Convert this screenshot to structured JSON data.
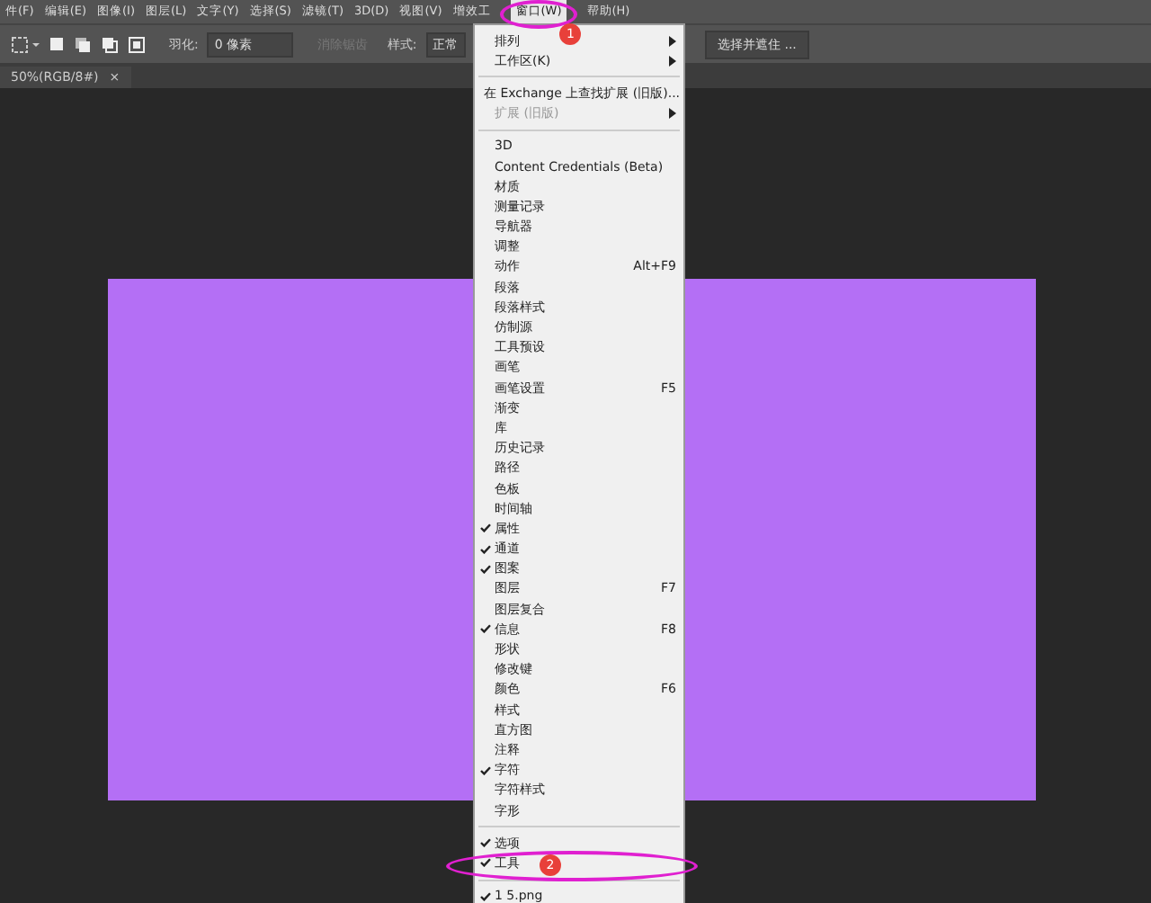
{
  "menubar": [
    {
      "label": "件(F)",
      "selected": false
    },
    {
      "label": "编辑(E)",
      "selected": false
    },
    {
      "label": "图像(I)",
      "selected": false
    },
    {
      "label": "图层(L)",
      "selected": false
    },
    {
      "label": "文字(Y)",
      "selected": false
    },
    {
      "label": "选择(S)",
      "selected": false
    },
    {
      "label": "滤镜(T)",
      "selected": false
    },
    {
      "label": "3D(D)",
      "selected": false
    },
    {
      "label": "视图(V)",
      "selected": false
    },
    {
      "label": "增效工",
      "selected": false
    },
    {
      "label": "窗口(W)",
      "selected": true
    },
    {
      "label": "帮助(H)",
      "selected": false
    }
  ],
  "options_bar": {
    "feather_label": "羽化:",
    "feather_value": "0 像素",
    "antialias": {
      "label": "消除锯齿",
      "disabled": true
    },
    "style_label": "样式:",
    "style_value": "正常",
    "select_mask_button": "选择并遮住 ..."
  },
  "document_tab": {
    "title": "50%(RGB/8#)",
    "close": "×"
  },
  "window_menu": [
    {
      "kind": "item",
      "label": "排列",
      "checked": false,
      "submenu": true,
      "disabled": false
    },
    {
      "kind": "item",
      "label": "工作区(K)",
      "checked": false,
      "submenu": true,
      "disabled": false
    },
    {
      "kind": "separator"
    },
    {
      "kind": "item",
      "label": "在 Exchange 上查找扩展 (旧版)...",
      "checked": false,
      "submenu": false,
      "disabled": false
    },
    {
      "kind": "item",
      "label": "扩展 (旧版)",
      "checked": false,
      "submenu": true,
      "disabled": true
    },
    {
      "kind": "separator"
    },
    {
      "kind": "item",
      "label": "3D",
      "checked": false,
      "submenu": false,
      "disabled": false
    },
    {
      "kind": "item",
      "label": "Content Credentials (Beta)",
      "checked": false,
      "submenu": false,
      "disabled": false
    },
    {
      "kind": "item",
      "label": "材质",
      "checked": false,
      "submenu": false,
      "disabled": false
    },
    {
      "kind": "item",
      "label": "测量记录",
      "checked": false,
      "submenu": false,
      "disabled": false
    },
    {
      "kind": "item",
      "label": "导航器",
      "checked": false,
      "submenu": false,
      "disabled": false
    },
    {
      "kind": "item",
      "label": "调整",
      "checked": false,
      "submenu": false,
      "disabled": false
    },
    {
      "kind": "item",
      "label": "动作",
      "shortcut": "Alt+F9",
      "checked": false,
      "submenu": false,
      "disabled": false
    },
    {
      "kind": "item",
      "label": "段落",
      "checked": false,
      "submenu": false,
      "disabled": false
    },
    {
      "kind": "item",
      "label": "段落样式",
      "checked": false,
      "submenu": false,
      "disabled": false
    },
    {
      "kind": "item",
      "label": "仿制源",
      "checked": false,
      "submenu": false,
      "disabled": false
    },
    {
      "kind": "item",
      "label": "工具预设",
      "checked": false,
      "submenu": false,
      "disabled": false
    },
    {
      "kind": "item",
      "label": "画笔",
      "checked": false,
      "submenu": false,
      "disabled": false
    },
    {
      "kind": "item",
      "label": "画笔设置",
      "shortcut": "F5",
      "checked": false,
      "submenu": false,
      "disabled": false
    },
    {
      "kind": "item",
      "label": "渐变",
      "checked": false,
      "submenu": false,
      "disabled": false
    },
    {
      "kind": "item",
      "label": "库",
      "checked": false,
      "submenu": false,
      "disabled": false
    },
    {
      "kind": "item",
      "label": "历史记录",
      "checked": false,
      "submenu": false,
      "disabled": false
    },
    {
      "kind": "item",
      "label": "路径",
      "checked": false,
      "submenu": false,
      "disabled": false
    },
    {
      "kind": "item",
      "label": "色板",
      "checked": false,
      "submenu": false,
      "disabled": false
    },
    {
      "kind": "item",
      "label": "时间轴",
      "checked": false,
      "submenu": false,
      "disabled": false
    },
    {
      "kind": "item",
      "label": "属性",
      "checked": true,
      "submenu": false,
      "disabled": false
    },
    {
      "kind": "item",
      "label": "通道",
      "checked": true,
      "submenu": false,
      "disabled": false
    },
    {
      "kind": "item",
      "label": "图案",
      "checked": true,
      "submenu": false,
      "disabled": false
    },
    {
      "kind": "item",
      "label": "图层",
      "shortcut": "F7",
      "checked": false,
      "submenu": false,
      "disabled": false
    },
    {
      "kind": "item",
      "label": "图层复合",
      "checked": false,
      "submenu": false,
      "disabled": false
    },
    {
      "kind": "item",
      "label": "信息",
      "shortcut": "F8",
      "checked": true,
      "submenu": false,
      "disabled": false
    },
    {
      "kind": "item",
      "label": "形状",
      "checked": false,
      "submenu": false,
      "disabled": false
    },
    {
      "kind": "item",
      "label": "修改键",
      "checked": false,
      "submenu": false,
      "disabled": false
    },
    {
      "kind": "item",
      "label": "颜色",
      "shortcut": "F6",
      "checked": false,
      "submenu": false,
      "disabled": false
    },
    {
      "kind": "item",
      "label": "样式",
      "checked": false,
      "submenu": false,
      "disabled": false
    },
    {
      "kind": "item",
      "label": "直方图",
      "checked": false,
      "submenu": false,
      "disabled": false
    },
    {
      "kind": "item",
      "label": "注释",
      "checked": false,
      "submenu": false,
      "disabled": false
    },
    {
      "kind": "item",
      "label": "字符",
      "checked": true,
      "submenu": false,
      "disabled": false
    },
    {
      "kind": "item",
      "label": "字符样式",
      "checked": false,
      "submenu": false,
      "disabled": false
    },
    {
      "kind": "item",
      "label": "字形",
      "checked": false,
      "submenu": false,
      "disabled": false
    },
    {
      "kind": "separator"
    },
    {
      "kind": "item",
      "label": "选项",
      "checked": true,
      "submenu": false,
      "disabled": false
    },
    {
      "kind": "item",
      "label": "工具",
      "checked": true,
      "submenu": false,
      "disabled": false
    },
    {
      "kind": "separator"
    },
    {
      "kind": "item",
      "label": "1 5.png",
      "checked": true,
      "submenu": false,
      "disabled": false
    }
  ],
  "annotations": [
    {
      "number": "1"
    },
    {
      "number": "2"
    }
  ]
}
